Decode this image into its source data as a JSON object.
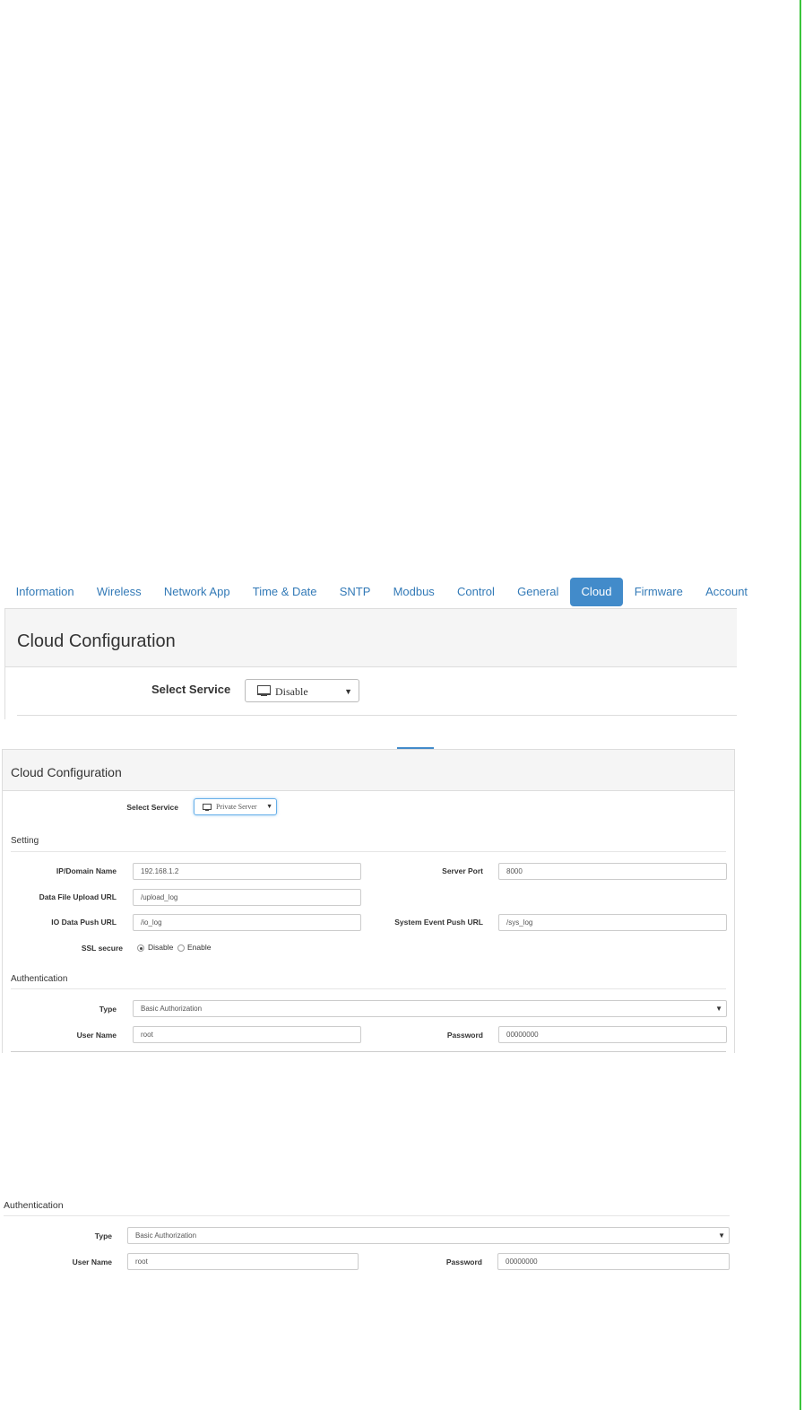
{
  "tabs": [
    "Information",
    "Wireless",
    "Network App",
    "Time & Date",
    "SNTP",
    "Modbus",
    "Control",
    "General",
    "Cloud",
    "Firmware",
    "Account"
  ],
  "active_tab": "Cloud",
  "panel1": {
    "title": "Cloud Configuration",
    "select_service_label": "Select Service",
    "service_value": "Disable",
    "icon": "monitor-icon"
  },
  "panel2": {
    "title": "Cloud Configuration",
    "select_service_label": "Select Service",
    "service_value": "Private Server",
    "setting_section": "Setting",
    "ip_label": "IP/Domain Name",
    "ip_value": "192.168.1.2",
    "port_label": "Server Port",
    "port_value": "8000",
    "upload_label": "Data File Upload URL",
    "upload_value": "/upload_log",
    "io_label": "IO Data Push URL",
    "io_value": "/io_log",
    "sys_label": "System Event Push URL",
    "sys_value": "/sys_log",
    "ssl_label": "SSL secure",
    "ssl_disable": "Disable",
    "ssl_enable": "Enable",
    "ssl_selected": "Disable",
    "auth_section": "Authentication",
    "type_label": "Type",
    "type_value": "Basic Authorization",
    "user_label": "User Name",
    "user_value": "root",
    "password_label": "Password",
    "password_value": "00000000"
  },
  "panel3": {
    "auth_section": "Authentication",
    "type_label": "Type",
    "type_value": "Basic Authorization",
    "user_label": "User Name",
    "user_value": "root",
    "password_label": "Password",
    "password_value": "00000000"
  },
  "colors": {
    "tab_active_bg": "#428bca",
    "link": "#337ab7",
    "panel_head_bg": "#f5f5f5",
    "right_edge_line": "#3bc43b"
  }
}
